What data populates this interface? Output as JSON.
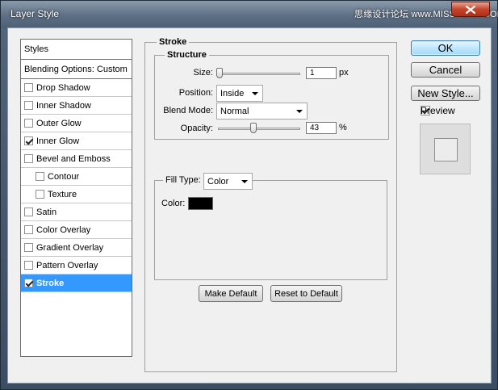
{
  "window": {
    "title": "Layer Style",
    "watermark": "思缘设计论坛 www.MISSYUAN.COM",
    "close_icon": "close-icon"
  },
  "style_list": {
    "header": "Styles",
    "blending": "Blending Options: Custom",
    "items": [
      {
        "label": "Drop Shadow",
        "checked": false,
        "indent": false
      },
      {
        "label": "Inner Shadow",
        "checked": false,
        "indent": false
      },
      {
        "label": "Outer Glow",
        "checked": false,
        "indent": false
      },
      {
        "label": "Inner Glow",
        "checked": true,
        "indent": false
      },
      {
        "label": "Bevel and Emboss",
        "checked": false,
        "indent": false
      },
      {
        "label": "Contour",
        "checked": false,
        "indent": true
      },
      {
        "label": "Texture",
        "checked": false,
        "indent": true
      },
      {
        "label": "Satin",
        "checked": false,
        "indent": false
      },
      {
        "label": "Color Overlay",
        "checked": false,
        "indent": false
      },
      {
        "label": "Gradient Overlay",
        "checked": false,
        "indent": false
      },
      {
        "label": "Pattern Overlay",
        "checked": false,
        "indent": false
      },
      {
        "label": "Stroke",
        "checked": true,
        "indent": false,
        "selected": true
      }
    ]
  },
  "stroke": {
    "title": "Stroke",
    "structure": {
      "title": "Structure",
      "size_label": "Size:",
      "size_value": "1",
      "size_unit": "px",
      "position_label": "Position:",
      "position_value": "Inside",
      "blend_label": "Blend Mode:",
      "blend_value": "Normal",
      "opacity_label": "Opacity:",
      "opacity_value": "43",
      "opacity_unit": "%"
    },
    "fill": {
      "fill_type_label": "Fill Type:",
      "fill_type_value": "Color",
      "color_label": "Color:",
      "color_value": "#000000"
    },
    "make_default": "Make Default",
    "reset_default": "Reset to Default"
  },
  "buttons": {
    "ok": "OK",
    "cancel": "Cancel",
    "new_style": "New Style...",
    "preview_label": "Preview",
    "preview_checked": true
  }
}
